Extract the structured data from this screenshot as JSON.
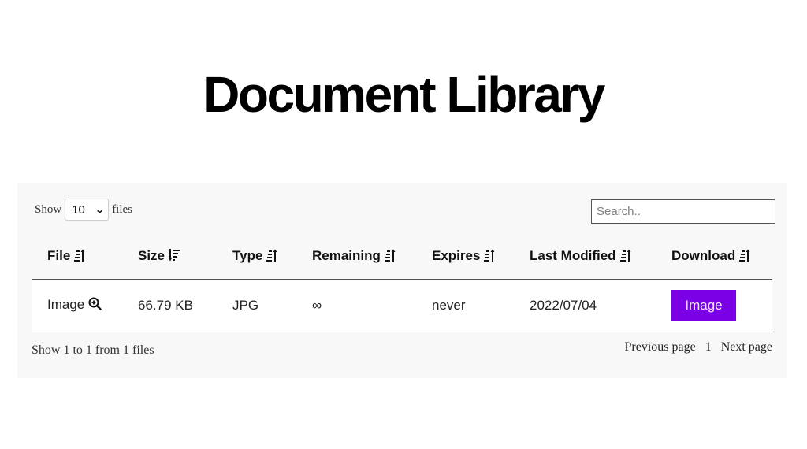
{
  "page": {
    "title": "Document Library"
  },
  "controls": {
    "show_label": "Show",
    "page_size": "10",
    "files_label": "files",
    "search_placeholder": "Search..",
    "search_value": ""
  },
  "table": {
    "columns": [
      {
        "label": "File",
        "sort_icon": "sort-ascending-icon"
      },
      {
        "label": "Size",
        "sort_icon": "sort-descending-icon"
      },
      {
        "label": "Type",
        "sort_icon": "sort-ascending-icon"
      },
      {
        "label": "Remaining",
        "sort_icon": "sort-ascending-icon"
      },
      {
        "label": "Expires",
        "sort_icon": "sort-ascending-icon"
      },
      {
        "label": "Last Modified",
        "sort_icon": "sort-ascending-icon"
      },
      {
        "label": "Download",
        "sort_icon": "sort-ascending-icon"
      }
    ],
    "rows": [
      {
        "file": "Image",
        "file_icon": "zoom-in-icon",
        "size": "66.79 KB",
        "type": "JPG",
        "remaining": "∞",
        "expires": "never",
        "last_modified": "2022/07/04",
        "download_label": "Image"
      }
    ]
  },
  "footer": {
    "info": "Show 1 to 1 from 1 files",
    "prev_label": "Previous page",
    "current_page": "1",
    "next_label": "Next page"
  },
  "colors": {
    "accent": "#7a00e6",
    "panel_bg": "#f8f8f8"
  }
}
